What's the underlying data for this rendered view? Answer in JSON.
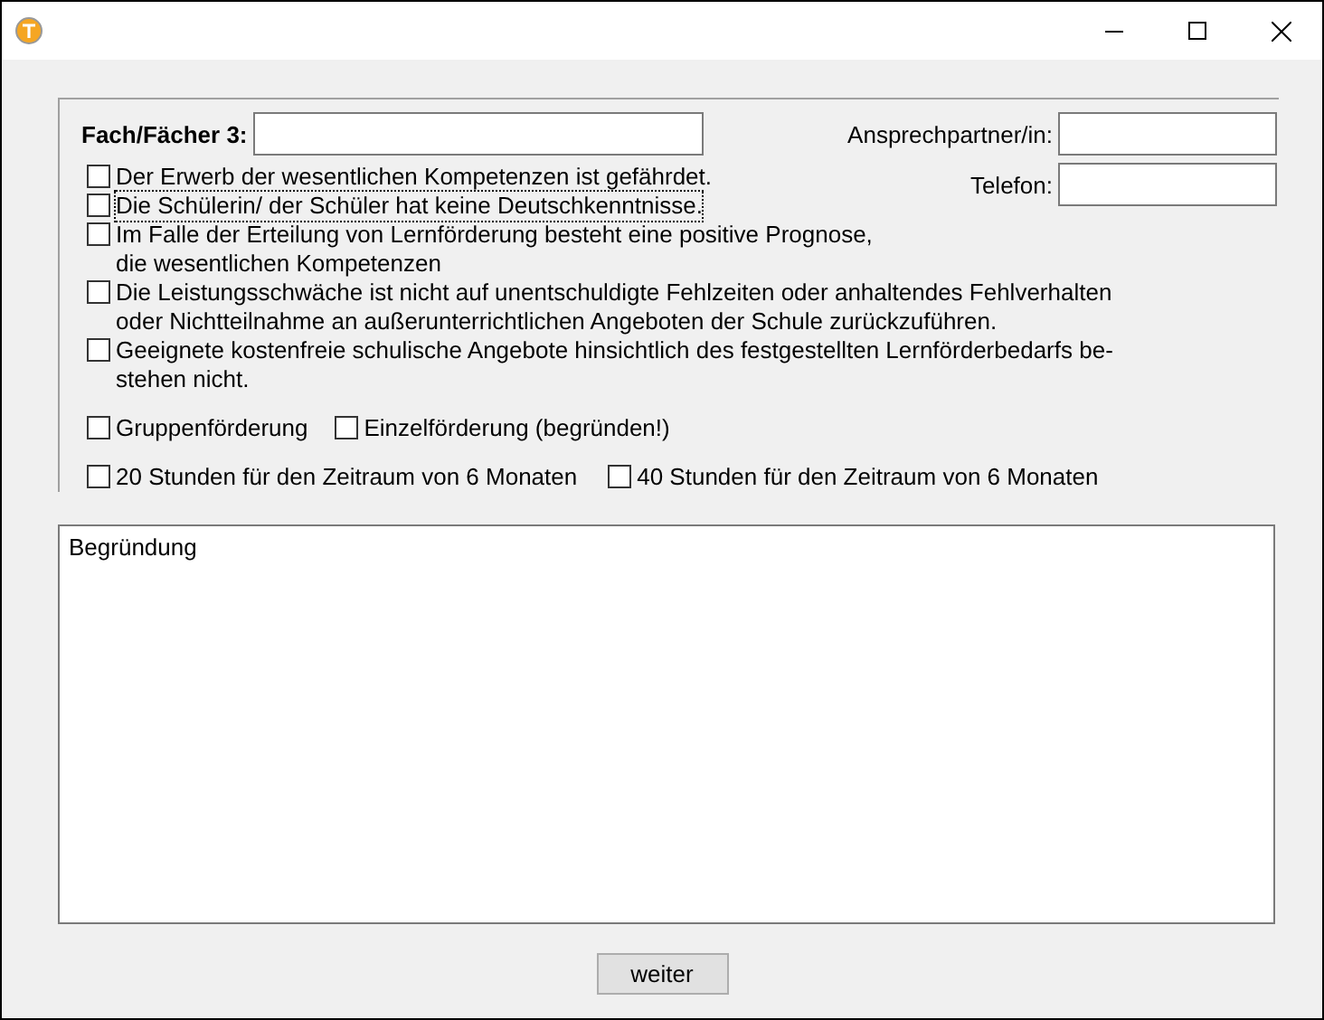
{
  "subject": {
    "label": "Fach/Fächer 3:"
  },
  "contact": {
    "label": "Ansprechpartner/in:"
  },
  "phone": {
    "label": "Telefon:"
  },
  "criteria": [
    {
      "lines": [
        "Der Erwerb der wesentlichen Kompetenzen ist gefährdet."
      ],
      "checked": false,
      "focused": false
    },
    {
      "lines": [
        "Die Schülerin/ der Schüler hat keine Deutschkenntnisse."
      ],
      "checked": false,
      "focused": true
    },
    {
      "lines": [
        "Im Falle der Erteilung von Lernförderung besteht eine positive Prognose,",
        "die wesentlichen Kompetenzen"
      ],
      "checked": false,
      "focused": false
    },
    {
      "lines": [
        "Die Leistungsschwäche ist nicht auf unentschuldigte Fehlzeiten oder anhaltendes Fehlverhalten",
        "oder Nichtteilnahme an außerunterrichtlichen Angeboten der Schule zurückzuführen."
      ],
      "checked": false,
      "focused": false
    },
    {
      "lines": [
        "Geeignete kostenfreie schulische Angebote hinsichtlich des festgestellten Lernförderbedarfs be-",
        "stehen nicht."
      ],
      "checked": false,
      "focused": false
    }
  ],
  "support_type": [
    {
      "text": "Gruppenförderung",
      "checked": false
    },
    {
      "text": "Einzelförderung (begründen!)",
      "checked": false
    }
  ],
  "hours": [
    {
      "text": "20 Stunden für den Zeitraum von 6 Monaten",
      "checked": false
    },
    {
      "text": "40 Stunden für den Zeitraum von 6 Monaten",
      "checked": false
    }
  ],
  "reason": {
    "value": "Begründung"
  },
  "buttons": [
    "weiter"
  ]
}
